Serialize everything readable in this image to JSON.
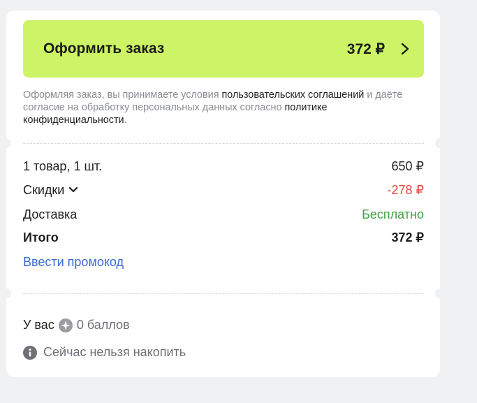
{
  "checkout": {
    "label": "Оформить заказ",
    "price": "372 ₽",
    "accent_color": "#cdf466"
  },
  "agreement": {
    "part1": "Оформляя заказ, вы принимаете условия ",
    "link1": "пользовательских соглашений",
    "part2": " и даёте согласие на обработку персональных данных согласно ",
    "link2": "политике конфиденциальности",
    "part3": "."
  },
  "summary": {
    "items_label": "1 товар, 1 шт.",
    "items_value": "650 ₽",
    "discount_label": "Скидки",
    "discount_value": "-278 ₽",
    "delivery_label": "Доставка",
    "delivery_value": "Бесплатно",
    "total_label": "Итого",
    "total_value": "372 ₽"
  },
  "promo": {
    "label": "Ввести промокод"
  },
  "bonus": {
    "prefix": "У вас",
    "points": "0 баллов",
    "note": "Сейчас нельзя накопить"
  },
  "icons": {
    "checkout_arrow": "chevron-right-icon",
    "discount_toggle": "chevron-down-icon",
    "points": "bonus-point-icon",
    "note": "info-icon"
  }
}
